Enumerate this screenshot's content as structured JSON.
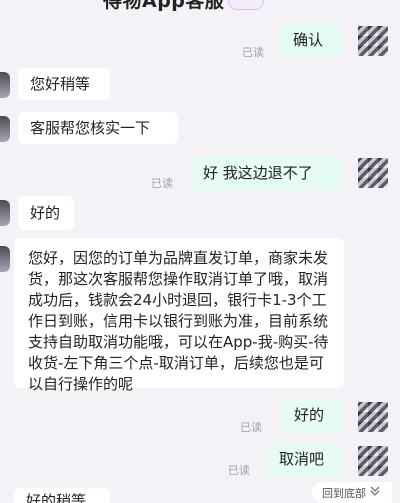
{
  "header": {
    "title": "得物App客服"
  },
  "messages": [
    {
      "side": "user",
      "text": "确认",
      "status": "已读"
    },
    {
      "side": "agent",
      "text": "您好稍等"
    },
    {
      "side": "agent",
      "text": "客服帮您核实一下"
    },
    {
      "side": "user",
      "text": "好 我这边退不了",
      "status": "已读"
    },
    {
      "side": "agent",
      "text": "好的"
    },
    {
      "side": "agent",
      "text": "您好，因您的订单为品牌直发订单，商家未发货，那这次客服帮您操作取消订单了哦，取消成功后，钱款会24小时退回，银行卡1-3个工作日到账，信用卡以银行到账为准，目前系统支持自助取消功能哦，可以在App-我-购买-待收货-左下角三个点-取消订单，后续您也是可以自行操作的呢"
    },
    {
      "side": "user",
      "text": "好的",
      "status": "已读"
    },
    {
      "side": "user",
      "text": "取消吧",
      "status": "已读"
    },
    {
      "side": "agent",
      "text": "好的稍等"
    }
  ],
  "back_to_bottom": {
    "label": "回到底部",
    "icon": "double-chevron-down-icon"
  }
}
